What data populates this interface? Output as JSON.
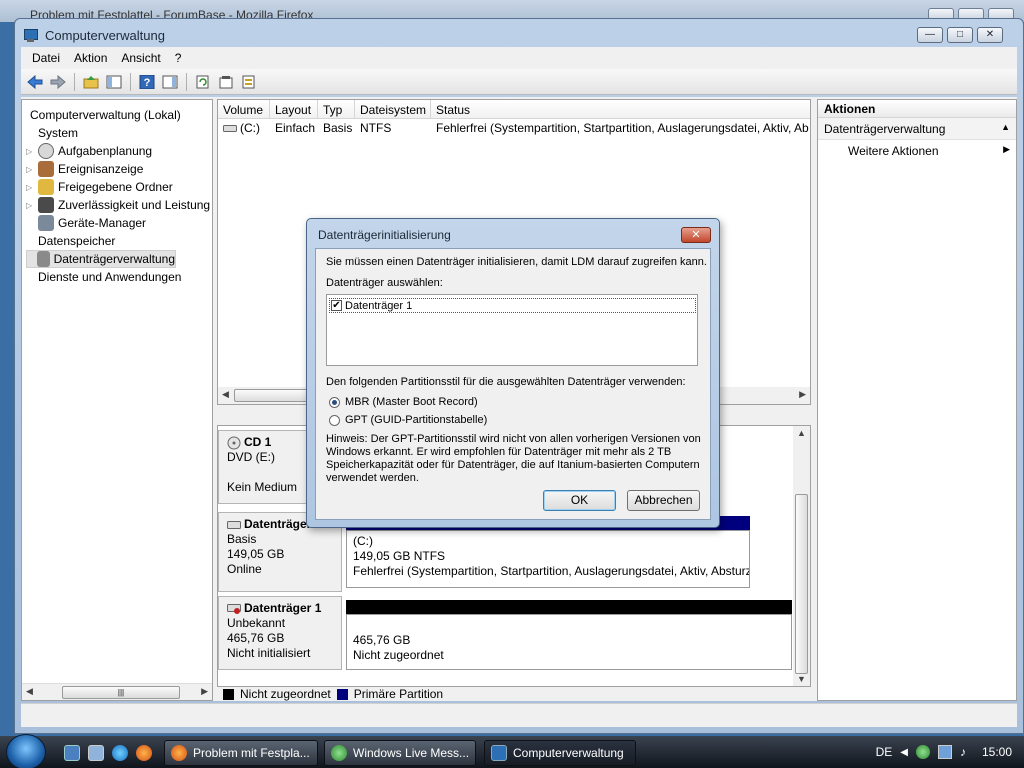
{
  "background_window": {
    "title": "Problem mit Festplattel - ForumBase - Mozilla Firefox"
  },
  "window": {
    "title": "Computerverwaltung",
    "controls": {
      "minimize": "—",
      "maximize": "□",
      "close": "✕"
    }
  },
  "menu": [
    "Datei",
    "Aktion",
    "Ansicht",
    "?"
  ],
  "toolbar": [
    "back-icon",
    "forward-icon",
    "up-folder-icon",
    "show-hide-tree-icon",
    "help-icon",
    "show-hide-action-icon",
    "refresh-icon",
    "properties-icon",
    "export-icon"
  ],
  "tree": {
    "items": [
      {
        "label": "Computerverwaltung (Lokal)",
        "level": 0,
        "icon": "computer-icon",
        "expander": ""
      },
      {
        "label": "System",
        "level": 1,
        "icon": "system-icon",
        "expander": ""
      },
      {
        "label": "Aufgabenplanung",
        "level": 2,
        "icon": "clock-icon",
        "expander": "▷"
      },
      {
        "label": "Ereignisanzeige",
        "level": 2,
        "icon": "event-viewer-icon",
        "expander": "▷"
      },
      {
        "label": "Freigegebene Ordner",
        "level": 2,
        "icon": "shared-folder-icon",
        "expander": "▷"
      },
      {
        "label": "Zuverlässigkeit und Leistung",
        "level": 2,
        "icon": "performance-icon",
        "expander": "▷"
      },
      {
        "label": "Geräte-Manager",
        "level": 2,
        "icon": "device-manager-icon",
        "expander": ""
      },
      {
        "label": "Datenspeicher",
        "level": 1,
        "icon": "storage-icon",
        "expander": ""
      },
      {
        "label": "Datenträgerverwaltung",
        "level": 2,
        "icon": "disk-management-icon",
        "expander": "",
        "selected": true
      },
      {
        "label": "Dienste und Anwendungen",
        "level": 1,
        "icon": "services-icon",
        "expander": ""
      }
    ],
    "scroll_thumb": "|||"
  },
  "volumes": {
    "headers": [
      "Volume",
      "Layout",
      "Typ",
      "Dateisystem",
      "Status"
    ],
    "rows": [
      {
        "volume": "(C:)",
        "layout": "Einfach",
        "typ": "Basis",
        "dateisystem": "NTFS",
        "status": "Fehlerfrei (Systempartition, Startpartition, Auslagerungsdatei, Aktiv, Ab"
      }
    ]
  },
  "disks": [
    {
      "name": "CD 1",
      "lines": [
        "DVD (E:)",
        "",
        "Kein Medium"
      ]
    },
    {
      "name": "Datenträger 0",
      "lines": [
        "Basis",
        "149,05 GB",
        "Online"
      ],
      "partition": {
        "title": "(C:)",
        "size": "149,05 GB NTFS",
        "status": "Fehlerfrei (Systempartition, Startpartition, Auslagerungsdatei, Aktiv, Absturz"
      }
    },
    {
      "name": "Datenträger 1",
      "lines": [
        "Unbekannt",
        "465,76 GB",
        "Nicht initialisiert"
      ],
      "partition": {
        "size": "465,76 GB",
        "status": "Nicht zugeordnet"
      }
    }
  ],
  "legend": [
    {
      "label": "Nicht zugeordnet",
      "color": "#000000"
    },
    {
      "label": "Primäre Partition",
      "color": "#00007f"
    }
  ],
  "actions": {
    "title": "Aktionen",
    "section": "Datenträgerverwaltung",
    "section_arrow": "▲",
    "more": "Weitere Aktionen",
    "more_arrow": "▶"
  },
  "dialog": {
    "title": "Datenträgerinitialisierung",
    "close": "✕",
    "intro": "Sie müssen einen Datenträger initialisieren, damit LDM darauf zugreifen kann.",
    "select_label": "Datenträger auswählen:",
    "disk_item": "Datenträger 1",
    "disk_checked": true,
    "style_label": "Den folgenden Partitionsstil für die ausgewählten Datenträger verwenden:",
    "mbr": "MBR (Master Boot Record)",
    "gpt": "GPT (GUID-Partitionstabelle)",
    "selected_style": "MBR",
    "hint_lines": [
      "Hinweis: Der GPT-Partitionsstil wird nicht von allen vorherigen Versionen von",
      "Windows erkannt. Er wird empfohlen für Datenträger mit mehr als 2 TB",
      "Speicherkapazität oder für Datenträger, die auf Itanium-basierten Computern",
      "verwendet werden."
    ],
    "ok": "OK",
    "cancel": "Abbrechen"
  },
  "taskbar": {
    "tasks": [
      {
        "label": "Problem mit Festpla...",
        "icon": "firefox-icon"
      },
      {
        "label": "Windows Live Mess...",
        "icon": "messenger-icon"
      },
      {
        "label": "Computerverwaltung",
        "icon": "computer-management-icon",
        "active": true
      }
    ],
    "language": "DE",
    "clock": "15:00"
  },
  "colors": {
    "unallocated": "#000000",
    "primary": "#00007f",
    "accent": "#3c7fb1"
  }
}
